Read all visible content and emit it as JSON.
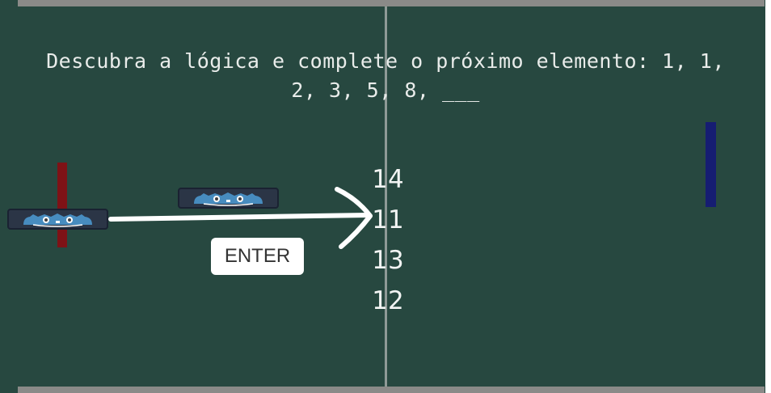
{
  "question": {
    "line1": "Descubra a lógica e complete o próximo elemento: 1, 1,",
    "line2": "2, 3, 5, 8, ___"
  },
  "answers": [
    "14",
    "11",
    "13",
    "12"
  ],
  "hint": {
    "key_label": "ENTER"
  },
  "colors": {
    "background": "#274840",
    "left_paddle": "#7e1216",
    "right_paddle": "#161d72",
    "net": "#8e9a96",
    "wall": "#8a8a88"
  },
  "icons": {
    "ball": "godot-logo-icon",
    "arrow": "arrow-right-icon"
  }
}
